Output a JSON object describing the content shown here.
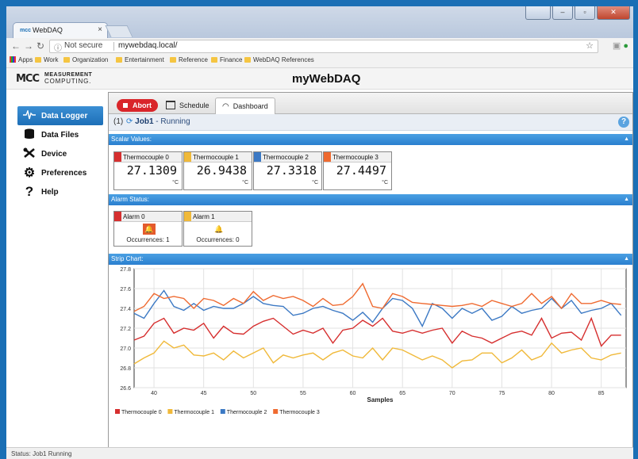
{
  "browser": {
    "tab_title": "WebDAQ",
    "tab_favicon": "mcc",
    "address": {
      "security": "Not secure",
      "url": "mywebdaq.local/"
    },
    "bookmarks": [
      "Apps",
      "Work",
      "Organization",
      "Entertainment",
      "Reference",
      "Finance",
      "WebDAQ References"
    ]
  },
  "app": {
    "logo_line1": "MEASUREMENT",
    "logo_line2": "COMPUTING.",
    "logo_mark": "MCC",
    "title": "myWebDAQ"
  },
  "sidebar": {
    "items": [
      {
        "label": "Data Logger",
        "icon": "waveform-icon"
      },
      {
        "label": "Data Files",
        "icon": "database-icon"
      },
      {
        "label": "Device",
        "icon": "tools-icon"
      },
      {
        "label": "Preferences",
        "icon": "gear-icon"
      },
      {
        "label": "Help",
        "icon": "question-icon"
      }
    ]
  },
  "toolbar": {
    "abort_label": "Abort",
    "tabs": [
      {
        "label": "Schedule"
      },
      {
        "label": "Dashboard"
      }
    ]
  },
  "job": {
    "number": "(1)",
    "name": "Job1",
    "state": "- Running"
  },
  "sections": {
    "scalar": "Scalar Values:",
    "alarm": "Alarm Status:",
    "strip": "Strip Chart:"
  },
  "thermocouples": [
    {
      "name": "Thermocouple 0",
      "value": "27.1309",
      "unit": "°C",
      "color": "#d62f2f"
    },
    {
      "name": "Thermocouple 1",
      "value": "26.9438",
      "unit": "°C",
      "color": "#f0b93a"
    },
    {
      "name": "Thermocouple 2",
      "value": "27.3318",
      "unit": "°C",
      "color": "#3c79c4"
    },
    {
      "name": "Thermocouple 3",
      "value": "27.4497",
      "unit": "°C",
      "color": "#ef6a30"
    }
  ],
  "alarms": [
    {
      "name": "Alarm 0",
      "occurrences": "Occurrences: 1",
      "color": "#d62f2f",
      "active": true
    },
    {
      "name": "Alarm 1",
      "occurrences": "Occurrences: 0",
      "color": "#f0b93a",
      "active": false
    }
  ],
  "chart_data": {
    "type": "line",
    "xlabel": "Samples",
    "ylabel": "",
    "xlim": [
      38,
      87.5
    ],
    "ylim": [
      26.6,
      27.8
    ],
    "xticks": [
      40,
      45,
      50,
      55,
      60,
      65,
      70,
      75,
      80,
      85
    ],
    "yticks": [
      26.6,
      26.8,
      27.0,
      27.2,
      27.4,
      27.6,
      27.8
    ],
    "ytick_labels": [
      "26.6",
      "26.8",
      "27.0",
      "27.2",
      "27.4",
      "27.6",
      "27.8"
    ],
    "grid": true,
    "legend_position": "bottom-left",
    "x": [
      38,
      39,
      40,
      41,
      42,
      43,
      44,
      45,
      46,
      47,
      48,
      49,
      50,
      51,
      52,
      53,
      54,
      55,
      56,
      57,
      58,
      59,
      60,
      61,
      62,
      63,
      64,
      65,
      66,
      67,
      68,
      69,
      70,
      71,
      72,
      73,
      74,
      75,
      76,
      77,
      78,
      79,
      80,
      81,
      82,
      83,
      84,
      85,
      86,
      87
    ],
    "series": [
      {
        "name": "Thermocouple 0",
        "color": "#d62f2f",
        "values": [
          27.08,
          27.12,
          27.25,
          27.3,
          27.15,
          27.2,
          27.18,
          27.25,
          27.1,
          27.22,
          27.15,
          27.14,
          27.22,
          27.27,
          27.3,
          27.22,
          27.14,
          27.18,
          27.15,
          27.2,
          27.05,
          27.18,
          27.2,
          27.28,
          27.22,
          27.3,
          27.17,
          27.15,
          27.18,
          27.15,
          27.18,
          27.2,
          27.05,
          27.17,
          27.12,
          27.1,
          27.05,
          27.1,
          27.15,
          27.17,
          27.13,
          27.3,
          27.1,
          27.15,
          27.16,
          27.08,
          27.3,
          27.02,
          27.13,
          27.13
        ]
      },
      {
        "name": "Thermocouple 1",
        "color": "#f0b93a",
        "values": [
          26.84,
          26.9,
          26.95,
          27.07,
          27.0,
          27.03,
          26.93,
          26.92,
          26.95,
          26.88,
          26.97,
          26.9,
          26.95,
          27.0,
          26.85,
          26.93,
          26.9,
          26.93,
          26.95,
          26.88,
          26.95,
          26.98,
          26.92,
          26.9,
          27.0,
          26.88,
          27.0,
          26.98,
          26.93,
          26.88,
          26.92,
          26.88,
          26.8,
          26.87,
          26.88,
          26.95,
          26.95,
          26.85,
          26.9,
          26.98,
          26.88,
          26.92,
          27.05,
          26.95,
          26.98,
          27.0,
          26.9,
          26.88,
          26.93,
          26.95
        ]
      },
      {
        "name": "Thermocouple 2",
        "color": "#3c79c4",
        "values": [
          27.35,
          27.3,
          27.45,
          27.58,
          27.42,
          27.38,
          27.45,
          27.38,
          27.42,
          27.4,
          27.4,
          27.45,
          27.52,
          27.45,
          27.43,
          27.42,
          27.33,
          27.35,
          27.4,
          27.42,
          27.38,
          27.35,
          27.28,
          27.36,
          27.26,
          27.4,
          27.5,
          27.48,
          27.4,
          27.22,
          27.45,
          27.4,
          27.3,
          27.4,
          27.35,
          27.4,
          27.28,
          27.32,
          27.42,
          27.35,
          27.38,
          27.4,
          27.5,
          27.4,
          27.48,
          27.35,
          27.38,
          27.4,
          27.45,
          27.33
        ]
      },
      {
        "name": "Thermocouple 3",
        "color": "#ef6a30",
        "values": [
          27.37,
          27.42,
          27.55,
          27.5,
          27.52,
          27.5,
          27.4,
          27.5,
          27.48,
          27.43,
          27.5,
          27.45,
          27.57,
          27.48,
          27.53,
          27.5,
          27.52,
          27.48,
          27.42,
          27.5,
          27.43,
          27.44,
          27.52,
          27.65,
          27.42,
          27.4,
          27.55,
          27.52,
          27.46,
          27.45,
          27.44,
          27.43,
          27.42,
          27.43,
          27.45,
          27.42,
          27.48,
          27.45,
          27.42,
          27.45,
          27.55,
          27.45,
          27.52,
          27.4,
          27.55,
          27.45,
          27.45,
          27.48,
          27.45,
          27.44
        ]
      }
    ]
  },
  "statusbar": "Status: Job1 Running"
}
